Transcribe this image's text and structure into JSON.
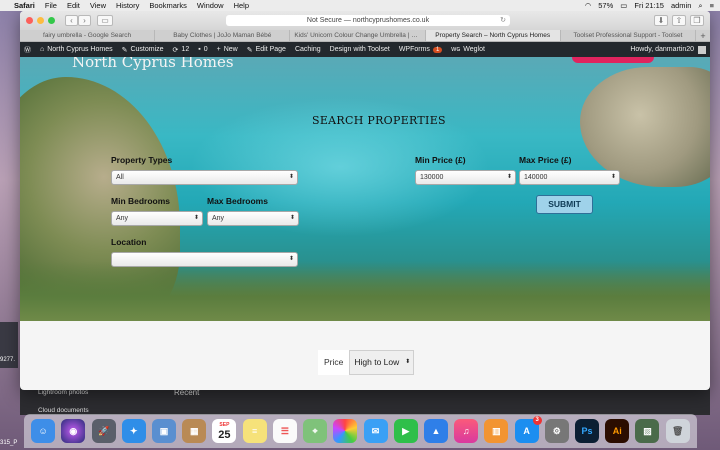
{
  "menubar": {
    "app": "Safari",
    "items": [
      "File",
      "Edit",
      "View",
      "History",
      "Bookmarks",
      "Window",
      "Help"
    ],
    "battery": "57%",
    "clock": "Fri 21:15",
    "user": "admin"
  },
  "desktop": {
    "label_1": "9277.",
    "label_2": "315_P"
  },
  "behind_app": {
    "item_1": "Lightroom photos",
    "item_2": "Cloud documents",
    "item_3": "Recent"
  },
  "browser": {
    "address": "Not Secure — northcyprushomes.co.uk",
    "tabs": [
      "fairy umbrella - Google Search",
      "Baby Clothes | JoJo Maman Bébé",
      "Kids' Unicorn Colour Change Umbrella | JoJo...",
      "Property Search – North Cyprus Homes",
      "Toolset Professional Support - Toolset"
    ]
  },
  "adminbar": {
    "site": "North Cyprus Homes",
    "customize": "Customize",
    "updates": "12",
    "comments": "0",
    "new": "New",
    "edit": "Edit Page",
    "caching": "Caching",
    "toolset": "Design with Toolset",
    "wpforms": "WPForms",
    "wpforms_badge": "1",
    "weglot": "Weglot",
    "howdy": "Howdy, danmartin20"
  },
  "page": {
    "site_title": "North Cyprus Homes",
    "search_title": "SEARCH PROPERTIES",
    "property_types_label": "Property Types",
    "property_types_value": "All",
    "min_bed_label": "Min Bedrooms",
    "min_bed_value": "Any",
    "max_bed_label": "Max Bedrooms",
    "max_bed_value": "Any",
    "location_label": "Location",
    "location_value": "",
    "min_price_label": "Min Price (£)",
    "min_price_value": "130000",
    "max_price_label": "Max Price (£)",
    "max_price_value": "140000",
    "submit": "SUBMIT",
    "sort_label": "Price",
    "sort_value": "High to Low"
  },
  "dock": {
    "calendar_month": "SEP",
    "calendar_day": "25",
    "appstore_badge": "3",
    "ps": "Ps",
    "ai": "Ai"
  },
  "colors": {
    "admin_bar": "#23282d",
    "submit_bg": "#9fd2ea",
    "accent_pink": "#e0245e",
    "wpforms_badge": "#d54e21"
  }
}
